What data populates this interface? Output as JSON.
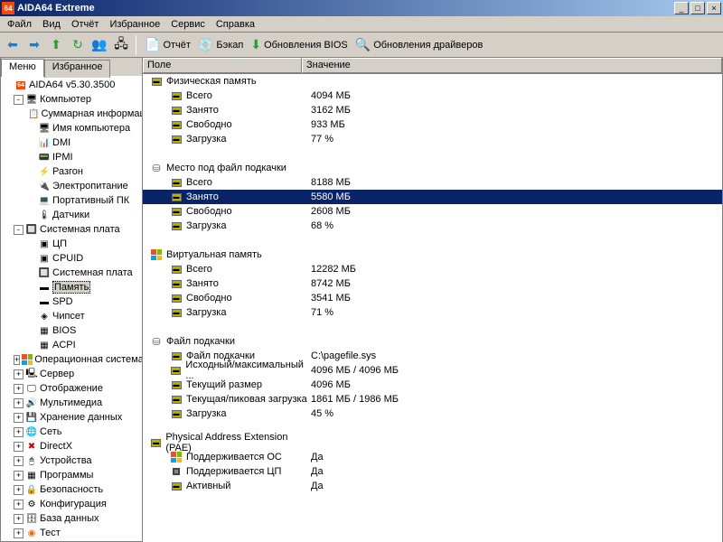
{
  "window": {
    "title": "AIDA64 Extreme",
    "icon_text": "64"
  },
  "menubar": [
    "Файл",
    "Вид",
    "Отчёт",
    "Избранное",
    "Сервис",
    "Справка"
  ],
  "toolbar_labeled": [
    {
      "icon": "📄",
      "label": "Отчёт",
      "name": "report-button"
    },
    {
      "icon": "💿",
      "label": "Бэкап",
      "name": "backup-button"
    },
    {
      "icon": "⬇",
      "label": "Обновления BIOS",
      "name": "bios-updates-button",
      "color": "#2a9d2a"
    },
    {
      "icon": "🔍",
      "label": "Обновления драйверов",
      "name": "driver-updates-button"
    }
  ],
  "sidebar": {
    "tabs": [
      {
        "label": "Меню",
        "active": true
      },
      {
        "label": "Избранное",
        "active": false
      }
    ],
    "root": "AIDA64 v5.30.3500",
    "tree": [
      {
        "exp": "-",
        "icon": "🖥",
        "label": "Компьютер",
        "children": [
          {
            "icon": "📋",
            "label": "Суммарная информация"
          },
          {
            "icon": "🖥",
            "label": "Имя компьютера"
          },
          {
            "icon": "📊",
            "label": "DMI"
          },
          {
            "icon": "📟",
            "label": "IPMI"
          },
          {
            "icon": "⚡",
            "label": "Разгон"
          },
          {
            "icon": "🔌",
            "label": "Электропитание"
          },
          {
            "icon": "💻",
            "label": "Портативный ПК"
          },
          {
            "icon": "🌡",
            "label": "Датчики"
          }
        ]
      },
      {
        "exp": "-",
        "icon": "🔲",
        "label": "Системная плата",
        "children": [
          {
            "icon": "▣",
            "label": "ЦП"
          },
          {
            "icon": "▣",
            "label": "CPUID"
          },
          {
            "icon": "🔲",
            "label": "Системная плата"
          },
          {
            "icon": "▬",
            "label": "Память",
            "selected": true
          },
          {
            "icon": "▬",
            "label": "SPD"
          },
          {
            "icon": "◈",
            "label": "Чипсет"
          },
          {
            "icon": "▦",
            "label": "BIOS"
          },
          {
            "icon": "▦",
            "label": "ACPI"
          }
        ]
      },
      {
        "exp": "+",
        "icon": "⊞",
        "label": "Операционная система",
        "flag": true
      },
      {
        "exp": "+",
        "icon": "🖳",
        "label": "Сервер"
      },
      {
        "exp": "+",
        "icon": "🖵",
        "label": "Отображение"
      },
      {
        "exp": "+",
        "icon": "🔊",
        "label": "Мультимедиа"
      },
      {
        "exp": "+",
        "icon": "💾",
        "label": "Хранение данных"
      },
      {
        "exp": "+",
        "icon": "🌐",
        "label": "Сеть"
      },
      {
        "exp": "+",
        "icon": "✖",
        "label": "DirectX",
        "color": "#c00"
      },
      {
        "exp": "+",
        "icon": "🖰",
        "label": "Устройства"
      },
      {
        "exp": "+",
        "icon": "▦",
        "label": "Программы"
      },
      {
        "exp": "+",
        "icon": "🔒",
        "label": "Безопасность"
      },
      {
        "exp": "+",
        "icon": "⚙",
        "label": "Конфигурация"
      },
      {
        "exp": "+",
        "icon": "🗄",
        "label": "База данных"
      },
      {
        "exp": "+",
        "icon": "◉",
        "label": "Тест",
        "color": "#f60"
      }
    ]
  },
  "content": {
    "headers": {
      "field": "Поле",
      "value": "Значение"
    },
    "groups": [
      {
        "title": "Физическая память",
        "icon": "chip",
        "rows": [
          {
            "field": "Всего",
            "value": "4094 МБ",
            "icon": "chip"
          },
          {
            "field": "Занято",
            "value": "3162 МБ",
            "icon": "chip"
          },
          {
            "field": "Свободно",
            "value": "933 МБ",
            "icon": "chip"
          },
          {
            "field": "Загрузка",
            "value": "77 %",
            "icon": "chip"
          }
        ]
      },
      {
        "title": "Место под файл подкачки",
        "icon": "disk",
        "rows": [
          {
            "field": "Всего",
            "value": "8188 МБ",
            "icon": "chip"
          },
          {
            "field": "Занято",
            "value": "5580 МБ",
            "icon": "chip",
            "selected": true
          },
          {
            "field": "Свободно",
            "value": "2608 МБ",
            "icon": "chip"
          },
          {
            "field": "Загрузка",
            "value": "68 %",
            "icon": "chip"
          }
        ]
      },
      {
        "title": "Виртуальная память",
        "icon": "flag",
        "rows": [
          {
            "field": "Всего",
            "value": "12282 МБ",
            "icon": "chip"
          },
          {
            "field": "Занято",
            "value": "8742 МБ",
            "icon": "chip"
          },
          {
            "field": "Свободно",
            "value": "3541 МБ",
            "icon": "chip"
          },
          {
            "field": "Загрузка",
            "value": "71 %",
            "icon": "chip"
          }
        ]
      },
      {
        "title": "Файл подкачки",
        "icon": "disk",
        "rows": [
          {
            "field": "Файл подкачки",
            "value": "C:\\pagefile.sys",
            "icon": "chip"
          },
          {
            "field": "Исходный/максимальный ...",
            "value": "4096 МБ / 4096 МБ",
            "icon": "chip"
          },
          {
            "field": "Текущий размер",
            "value": "4096 МБ",
            "icon": "chip"
          },
          {
            "field": "Текущая/пиковая загрузка",
            "value": "1861 МБ / 1986 МБ",
            "icon": "chip"
          },
          {
            "field": "Загрузка",
            "value": "45 %",
            "icon": "chip"
          }
        ]
      },
      {
        "title": "Physical Address Extension (PAE)",
        "icon": "chip",
        "rows": [
          {
            "field": "Поддерживается ОС",
            "value": "Да",
            "icon": "flag"
          },
          {
            "field": "Поддерживается ЦП",
            "value": "Да",
            "icon": "cpu"
          },
          {
            "field": "Активный",
            "value": "Да",
            "icon": "chip"
          }
        ]
      }
    ]
  }
}
